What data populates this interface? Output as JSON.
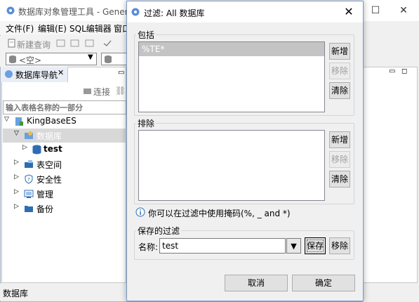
{
  "main_window": {
    "title": "数据库对象管理工具 - General",
    "menu": [
      "文件(F)",
      "编辑(E)",
      "SQL编辑器",
      "窗口"
    ],
    "toolbar": {
      "new_query_label": "新建查询",
      "combo_value": "<空>"
    },
    "navigator": {
      "tab_label": "数据库导航",
      "connect_label": "连接",
      "filter_placeholder": "输入表格名称的一部分",
      "tree": [
        {
          "label": "KingBaseES",
          "level": 0,
          "expanded": true
        },
        {
          "label": "数据库",
          "level": 1,
          "expanded": true,
          "selected": true
        },
        {
          "label": "test",
          "level": 2,
          "bold": true
        },
        {
          "label": "表空间",
          "level": 1
        },
        {
          "label": "安全性",
          "level": 1
        },
        {
          "label": "管理",
          "level": 1
        },
        {
          "label": "备份",
          "level": 1
        }
      ]
    },
    "status_bar_text": "数据库"
  },
  "dialog": {
    "title": "过滤: All 数据库",
    "include": {
      "label": "包括",
      "items": [
        "%TE*"
      ],
      "add_label": "新增",
      "remove_label": "移除",
      "clear_label": "清除"
    },
    "exclude": {
      "label": "排除",
      "items": [],
      "add_label": "新增",
      "remove_label": "移除",
      "clear_label": "清除"
    },
    "hint": "你可以在过滤中使用掩码(%, _ and *)",
    "saved": {
      "label": "保存的过滤",
      "name_label": "名称:",
      "name_value": "test",
      "save_label": "保存",
      "remove_label": "移除"
    },
    "cancel_label": "取消",
    "ok_label": "确定"
  },
  "colors": {
    "accent": "#2e6db4",
    "selection": "#c4c4c4",
    "tree_selection": "#d8d8d8"
  }
}
